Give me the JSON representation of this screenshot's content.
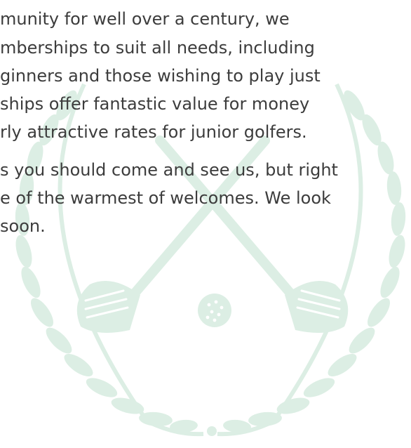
{
  "paragraphs": [
    {
      "lines": [
        "munity for well over a century, we",
        "mberships to suit all needs, including",
        "ginners and those wishing to play just",
        "ships offer fantastic value for money",
        "rly attractive rates for junior golfers."
      ]
    },
    {
      "lines": [
        "s you should come and see us, but right",
        "e of the warmest of welcomes. We look",
        "soon."
      ]
    }
  ],
  "colors": {
    "text": "#3c3c3c",
    "watermark": "#dceee4",
    "background": "#ffffff"
  },
  "icons": {
    "watermark": "golf-club-crest-icon"
  }
}
